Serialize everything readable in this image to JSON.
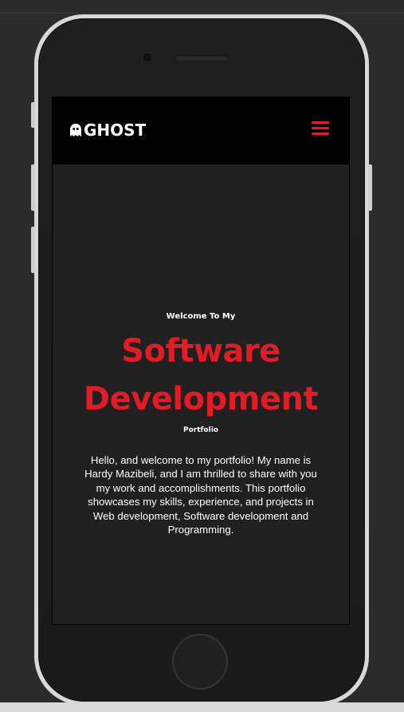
{
  "navbar": {
    "logo_text": "GHOST",
    "logo_icon": "ghost-icon",
    "menu_icon": "hamburger-menu-icon",
    "accent_color": "#e21c25"
  },
  "hero": {
    "welcome": "Welcome To My",
    "headline_line1": "Software",
    "headline_line2": "Development",
    "subtitle": "Portfolio",
    "intro": "Hello, and welcome to my portfolio! My name is Hardy Mazibeli, and I am thrilled to share with you my work and accomplishments. This portfolio showcases my skills, experience, and projects in Web development, Software development and Programming."
  }
}
